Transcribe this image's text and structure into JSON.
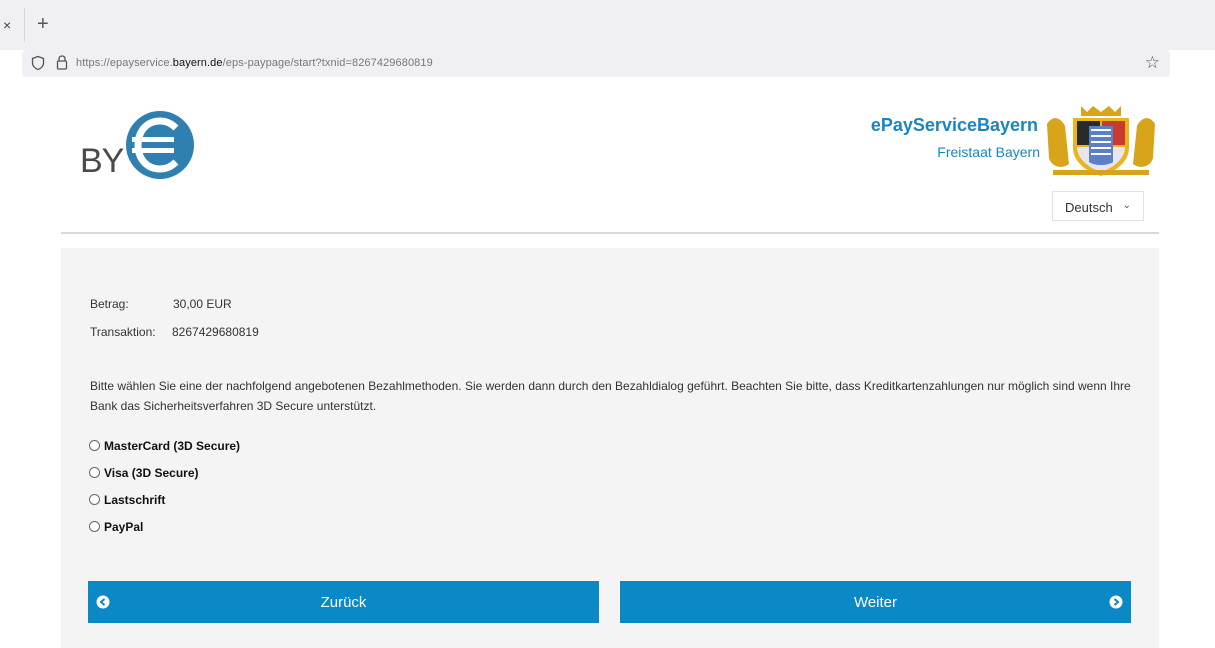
{
  "browser": {
    "close_tab_glyph": "×",
    "new_tab_glyph": "+",
    "url_prefix": "https://epayservice.",
    "url_domain": "bayern.de",
    "url_path": "/eps-paypage/start?txnid=8267429680819",
    "icons": [
      "shield-icon",
      "lock-icon",
      "bookmark-star-icon"
    ]
  },
  "header": {
    "logo_text": "BY",
    "brand_title": "ePayServiceBayern",
    "brand_subtitle": "Freistaat Bayern",
    "language": "Deutsch",
    "accent_color": "#1a86c0"
  },
  "transaction": {
    "amount_label": "Betrag:",
    "amount_value": "30,00 EUR",
    "txn_label": "Transaktion:",
    "txn_value": "8267429680819"
  },
  "instructions": "Bitte wählen Sie eine der nachfolgend angebotenen Bezahlmethoden. Sie werden dann durch den Bezahldialog geführt. Beachten Sie bitte, dass Kreditkartenzahlungen nur möglich sind wenn Ihre Bank das Sicherheitsverfahren 3D Secure unterstützt.",
  "payment_methods": [
    {
      "label": "MasterCard (3D Secure)",
      "selected": false
    },
    {
      "label": "Visa (3D Secure)",
      "selected": false
    },
    {
      "label": "Lastschrift",
      "selected": false
    },
    {
      "label": "PayPal",
      "selected": false
    }
  ],
  "actions": {
    "back_label": "Zurück",
    "next_label": "Weiter",
    "button_color": "#0b88c6"
  }
}
